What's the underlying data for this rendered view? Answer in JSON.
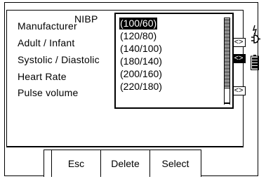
{
  "panel": {
    "title": "NIBP"
  },
  "fields": [
    {
      "label": "Manufacturer",
      "button": "<>"
    },
    {
      "label": "Adult / Infant",
      "button": "<>"
    },
    {
      "label": "Systolic / Diastolic",
      "button": "<>"
    },
    {
      "label": "Heart Rate",
      "button": ""
    },
    {
      "label": "Pulse volume",
      "button": "<>"
    }
  ],
  "dropdown": {
    "options": [
      "(100/60)",
      "(120/80)",
      "(140/100)",
      "(180/140)",
      "(200/160)",
      "(220/180)"
    ],
    "selected_index": 0,
    "scroll_position": 0.8
  },
  "softkeys": [
    "",
    "Esc",
    "Delete",
    "Select"
  ],
  "icons": {
    "mains": "plug-icon",
    "battery": "battery-icon"
  }
}
